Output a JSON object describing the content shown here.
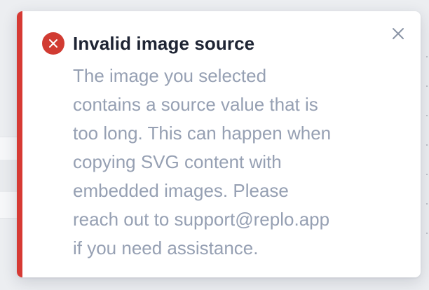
{
  "toast": {
    "title": "Invalid image source",
    "message": "The image you selected\ncontains a source value that is\ntoo long. This can happen when\ncopying SVG content with\nembedded images. Please\nreach out to support@replo.app\nif you need assistance.",
    "icon": "error-circle-x-icon",
    "close_icon": "close-x-icon",
    "colors": {
      "accent": "#d63a34",
      "icon_bg": "#d13b32",
      "title": "#1e2433",
      "message": "#96a0b3",
      "close": "#8a94a6"
    }
  }
}
